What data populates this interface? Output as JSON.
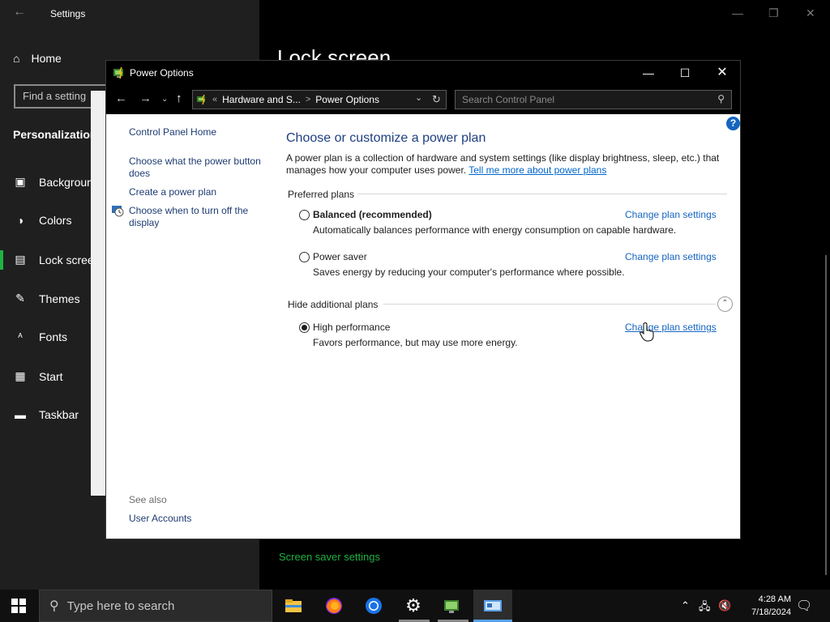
{
  "settings": {
    "title": "Settings",
    "home_label": "Home",
    "find_placeholder": "Find a setting",
    "category": "Personalization",
    "nav_items": [
      {
        "icon": "image-icon",
        "label": "Background"
      },
      {
        "icon": "palette-icon",
        "label": "Colors"
      },
      {
        "icon": "lock-screen-icon",
        "label": "Lock screen"
      },
      {
        "icon": "themes-icon",
        "label": "Themes"
      },
      {
        "icon": "fonts-icon",
        "label": "Fonts"
      },
      {
        "icon": "start-icon",
        "label": "Start"
      },
      {
        "icon": "taskbar-icon",
        "label": "Taskbar"
      }
    ],
    "page_heading": "Lock screen",
    "screen_saver_link": "Screen saver settings",
    "accent_color": "#1fb141"
  },
  "power_options": {
    "window_title": "Power Options",
    "address": {
      "crumb_prefix": "«",
      "crumb1": "Hardware and S...",
      "crumb_sep": ">",
      "crumb2": "Power Options"
    },
    "search_placeholder": "Search Control Panel",
    "left_panel": {
      "home_link": "Control Panel Home",
      "links": [
        "Choose what the power button does",
        "Create a power plan",
        "Choose when to turn off the display"
      ],
      "see_also_label": "See also",
      "see_also_links": [
        "User Accounts"
      ]
    },
    "heading": "Choose or customize a power plan",
    "description": "A power plan is a collection of hardware and system settings (like display brightness, sleep, etc.) that manages how your computer uses power.",
    "description_link": "Tell me more about power plans",
    "preferred_label": "Preferred plans",
    "hidden_label": "Hide additional plans",
    "change_link": "Change plan settings",
    "plans": [
      {
        "name": "Balanced (recommended)",
        "desc": "Automatically balances performance with energy consumption on capable hardware.",
        "selected": false,
        "bold": true
      },
      {
        "name": "Power saver",
        "desc": "Saves energy by reducing your computer's performance where possible.",
        "selected": false,
        "bold": false
      },
      {
        "name": "High performance",
        "desc": "Favors performance, but may use more energy.",
        "selected": true,
        "bold": false
      }
    ]
  },
  "taskbar": {
    "search_placeholder": "Type here to search",
    "apps": [
      "file-explorer-icon",
      "firefox-icon",
      "chrome-icon",
      "settings-gear-icon",
      "control-panel-icon",
      "power-options-icon"
    ],
    "time": "4:28 AM",
    "date": "7/18/2024"
  }
}
